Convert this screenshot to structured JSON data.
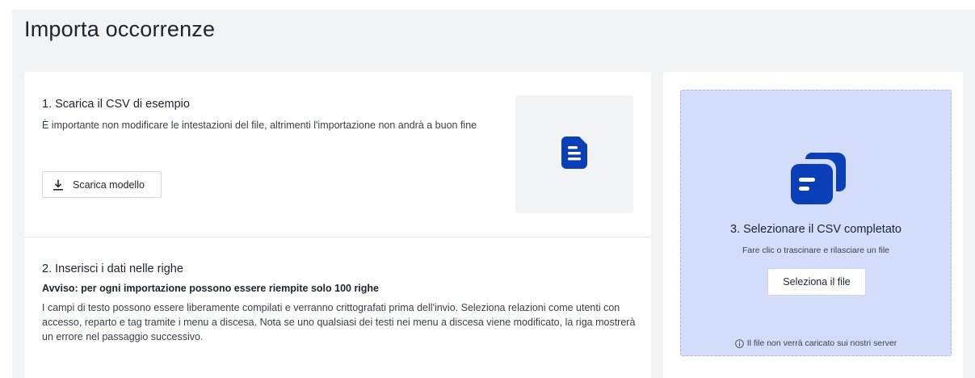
{
  "page": {
    "title": "Importa occorrenze"
  },
  "step1": {
    "title": "1. Scarica il CSV di esempio",
    "description": "È importante non modificare le intestazioni del file, altrimenti l'importazione non andrà a buon fine",
    "button_label": "Scarica modello",
    "button_icon": "download-icon",
    "tile_icon": "document-icon"
  },
  "step2": {
    "title": "2. Inserisci i dati nelle righe",
    "warning": "Avviso: per ogni importazione possono essere riempite solo 100 righe",
    "description": "I campi di testo possono essere liberamente compilati e verranno crittografati prima dell'invio. Seleziona relazioni come utenti con accesso, reparto e tag tramite i menu a discesa. Nota se uno qualsiasi dei testi nei menu a discesa viene modificato, la riga mostrerà un errore nel passaggio successivo."
  },
  "step3": {
    "title": "3. Selezionare il CSV completato",
    "subtitle": "Fare clic o trascinare e rilasciare un file",
    "button_label": "Seleziona il file",
    "note": "Il file non verrà caricato sui nostri server",
    "icon": "documents-stack-icon",
    "note_icon": "info-icon"
  },
  "colors": {
    "accent": "#0a3fb8",
    "dropzone_bg": "#d3ddfb",
    "page_bg": "#f2f3f5"
  }
}
